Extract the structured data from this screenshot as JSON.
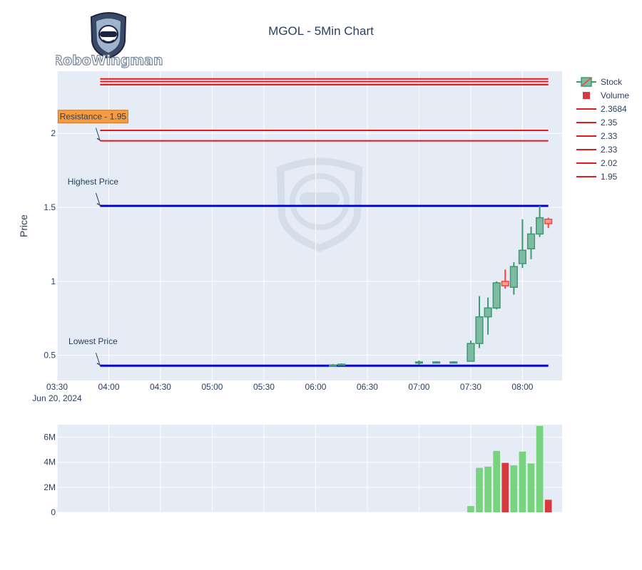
{
  "title": "MGOL - 5Min Chart",
  "logo": {
    "brand": "RoboWingman"
  },
  "colors": {
    "plot_bg": "#e5ecf6",
    "grid": "#ffffff",
    "up": "#3d9970",
    "up_fill": "#7dbca3",
    "down": "#ff4136",
    "down_fill": "#ff9a94",
    "resistance_line": "#e31a1c",
    "extreme_line": "#0000cc",
    "vol_up": "#77d37d",
    "vol_down": "#d8393f",
    "annotation_bg": "#f39c45",
    "text": "#2a3f5f"
  },
  "chart_data": [
    {
      "type": "candlestick",
      "title": "MGOL - 5Min Chart",
      "ylabel": "Price",
      "ylim": [
        0.33,
        2.42
      ],
      "yticks": [
        0.5,
        1,
        1.5,
        2
      ],
      "ytick_labels": [
        "0.5",
        "1",
        "1.5",
        "2"
      ],
      "x_first_tick": "03:30",
      "x_first_tick_date": "Jun 20, 2024",
      "xticks": [
        "03:30",
        "04:00",
        "04:30",
        "05:00",
        "05:30",
        "06:00",
        "06:30",
        "07:00",
        "07:30",
        "08:00"
      ],
      "x_range_minutes_since_midnight": [
        210,
        503
      ],
      "legend_position": "top-right",
      "series": [
        {
          "name": "Stock",
          "kind": "ohlc",
          "candles": [
            {
              "time": "06:10",
              "open": 0.435,
              "high": 0.44,
              "low": 0.43,
              "close": 0.435
            },
            {
              "time": "06:15",
              "open": 0.44,
              "high": 0.445,
              "low": 0.435,
              "close": 0.44
            },
            {
              "time": "07:00",
              "open": 0.45,
              "high": 0.465,
              "low": 0.435,
              "close": 0.455
            },
            {
              "time": "07:10",
              "open": 0.455,
              "high": 0.46,
              "low": 0.45,
              "close": 0.455
            },
            {
              "time": "07:20",
              "open": 0.455,
              "high": 0.46,
              "low": 0.45,
              "close": 0.455
            },
            {
              "time": "07:30",
              "open": 0.46,
              "high": 0.6,
              "low": 0.46,
              "close": 0.58
            },
            {
              "time": "07:35",
              "open": 0.58,
              "high": 0.9,
              "low": 0.55,
              "close": 0.76
            },
            {
              "time": "07:40",
              "open": 0.76,
              "high": 0.89,
              "low": 0.64,
              "close": 0.82
            },
            {
              "time": "07:45",
              "open": 0.82,
              "high": 1.0,
              "low": 0.81,
              "close": 0.99
            },
            {
              "time": "07:50",
              "open": 1.0,
              "high": 1.08,
              "low": 0.95,
              "close": 0.97
            },
            {
              "time": "07:55",
              "open": 0.96,
              "high": 1.13,
              "low": 0.91,
              "close": 1.1
            },
            {
              "time": "08:00",
              "open": 1.12,
              "high": 1.42,
              "low": 1.09,
              "close": 1.21
            },
            {
              "time": "08:05",
              "open": 1.22,
              "high": 1.37,
              "low": 1.15,
              "close": 1.32
            },
            {
              "time": "08:10",
              "open": 1.32,
              "high": 1.51,
              "low": 1.3,
              "close": 1.43
            },
            {
              "time": "08:15",
              "open": 1.42,
              "high": 1.43,
              "low": 1.36,
              "close": 1.39
            }
          ]
        },
        {
          "name": "2.3684",
          "kind": "hline",
          "y": 2.3684,
          "from": "03:55",
          "to": "08:15"
        },
        {
          "name": "2.35",
          "kind": "hline",
          "y": 2.35,
          "from": "03:55",
          "to": "08:15"
        },
        {
          "name": "2.33",
          "kind": "hline",
          "y": 2.33,
          "from": "03:55",
          "to": "08:15"
        },
        {
          "name": "2.33",
          "kind": "hline",
          "y": 2.33,
          "from": "03:55",
          "to": "08:15"
        },
        {
          "name": "2.02",
          "kind": "hline",
          "y": 2.02,
          "from": "03:55",
          "to": "08:15"
        },
        {
          "name": "1.95",
          "kind": "hline",
          "y": 1.95,
          "from": "03:55",
          "to": "08:15"
        }
      ],
      "reference_lines": [
        {
          "role": "highest",
          "y": 1.51,
          "from": "03:55",
          "to": "08:15"
        },
        {
          "role": "lowest",
          "y": 0.43,
          "from": "03:55",
          "to": "08:15"
        }
      ],
      "annotations": [
        {
          "text": "Resistance - 1.95",
          "at_time": "03:55",
          "at_y": 1.95,
          "boxed": true
        },
        {
          "text": "Highest Price",
          "at_time": "03:55",
          "at_y": 1.51,
          "boxed": false
        },
        {
          "text": "Lowest Price",
          "at_time": "03:55",
          "at_y": 0.43,
          "boxed": false
        }
      ]
    },
    {
      "type": "bar",
      "name": "Volume",
      "ylim": [
        0,
        7000000
      ],
      "yticks": [
        0,
        2000000,
        4000000,
        6000000
      ],
      "ytick_labels": [
        "0",
        "2M",
        "4M",
        "6M"
      ],
      "bars": [
        {
          "time": "07:30",
          "value": 500000,
          "direction": "up"
        },
        {
          "time": "07:35",
          "value": 3550000,
          "direction": "up"
        },
        {
          "time": "07:40",
          "value": 3650000,
          "direction": "up"
        },
        {
          "time": "07:45",
          "value": 4900000,
          "direction": "up"
        },
        {
          "time": "07:50",
          "value": 3950000,
          "direction": "down"
        },
        {
          "time": "07:55",
          "value": 3750000,
          "direction": "up"
        },
        {
          "time": "08:00",
          "value": 4850000,
          "direction": "up"
        },
        {
          "time": "08:05",
          "value": 3900000,
          "direction": "up"
        },
        {
          "time": "08:10",
          "value": 6900000,
          "direction": "up"
        },
        {
          "time": "08:15",
          "value": 1000000,
          "direction": "down"
        }
      ]
    }
  ],
  "legend": [
    {
      "label": "Stock",
      "kind": "candle"
    },
    {
      "label": "Volume",
      "kind": "square"
    },
    {
      "label": "2.3684",
      "kind": "line"
    },
    {
      "label": "2.35",
      "kind": "line"
    },
    {
      "label": "2.33",
      "kind": "line"
    },
    {
      "label": "2.33",
      "kind": "line"
    },
    {
      "label": "2.02",
      "kind": "line"
    },
    {
      "label": "1.95",
      "kind": "line"
    }
  ]
}
